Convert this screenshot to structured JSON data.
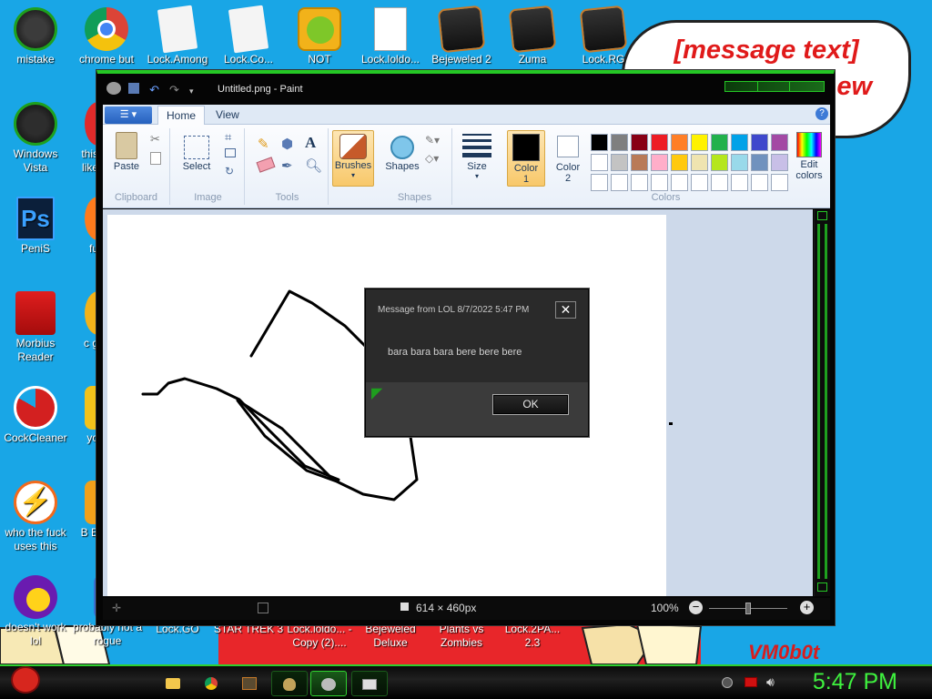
{
  "wallpaper": {
    "bubble_line1": "[message text]",
    "bubble_line2": "ew",
    "signature": "VM0b0t"
  },
  "desktop_icons": [
    {
      "name": "mistake",
      "label": "mistake"
    },
    {
      "name": "chrome",
      "label": "chrome but nor"
    },
    {
      "name": "lock-among",
      "label": "Lock.Among"
    },
    {
      "name": "lock-co",
      "label": "Lock.Co..."
    },
    {
      "name": "not",
      "label": "NOT"
    },
    {
      "name": "lock-loldo",
      "label": "Lock.loldo..."
    },
    {
      "name": "bejeweled-2",
      "label": "Bejeweled 2"
    },
    {
      "name": "zuma",
      "label": "Zuma"
    },
    {
      "name": "lock-rg",
      "label": "Lock.RG"
    },
    {
      "name": "windows-vista",
      "label": "Windows Vista"
    },
    {
      "name": "this-like",
      "label": "this like"
    },
    {
      "name": "penis",
      "label": "PeniS"
    },
    {
      "name": "fu",
      "label": "fu"
    },
    {
      "name": "morbius-reader",
      "label": "Morbius Reader"
    },
    {
      "name": "c-g",
      "label": "c g"
    },
    {
      "name": "cockcleaner",
      "label": "CockCleaner"
    },
    {
      "name": "yo",
      "label": "yo"
    },
    {
      "name": "who-uses-this",
      "label": "who the fuck uses this"
    },
    {
      "name": "b-e",
      "label": "B E"
    },
    {
      "name": "doesnt-work",
      "label": "doesn't work lol"
    },
    {
      "name": "probably-not-rogue",
      "label": "probably not a rogue"
    },
    {
      "name": "lock-go",
      "label": "Lock.GO"
    },
    {
      "name": "star-trek-3",
      "label": "STAR TREK 3"
    },
    {
      "name": "lock-loldo-copy",
      "label": "Lock.loldo... - Copy (2)...."
    },
    {
      "name": "bejeweled-deluxe",
      "label": "Bejeweled Deluxe"
    },
    {
      "name": "plants-vs-zombies",
      "label": "Plants vs Zombies"
    },
    {
      "name": "lock-2pa",
      "label": "Lock.2PA... 2.3"
    }
  ],
  "paint": {
    "title": "Untitled.png - Paint",
    "tabs": [
      "Home",
      "View"
    ],
    "groups": {
      "clipboard": "Clipboard",
      "image": "Image",
      "tools": "Tools",
      "shapes": "Shapes",
      "colors": "Colors"
    },
    "buttons": {
      "paste": "Paste",
      "select": "Select",
      "brushes": "Brushes",
      "shapes": "Shapes",
      "size": "Size",
      "color1": "Color 1",
      "color2": "Color 2",
      "edit_colors": "Edit colors"
    },
    "palette_row1": [
      "#000000",
      "#7f7f7f",
      "#880015",
      "#ed1c24",
      "#ff7f27",
      "#fff200",
      "#22b14c",
      "#00a2e8",
      "#3f48cc",
      "#a349a4"
    ],
    "palette_row2": [
      "#ffffff",
      "#c3c3c3",
      "#b97a57",
      "#ffaec9",
      "#ffc90e",
      "#efe4b0",
      "#b5e61d",
      "#99d9ea",
      "#7092be",
      "#c8bfe7"
    ],
    "status": {
      "size": "614 × 460px",
      "zoom": "100%"
    }
  },
  "dialog": {
    "title": "Message from LOL 8/7/2022 5:47 PM",
    "message": "bara bara bara bere bere bere",
    "ok": "OK"
  },
  "taskbar": {
    "clock": "5:47 PM"
  }
}
